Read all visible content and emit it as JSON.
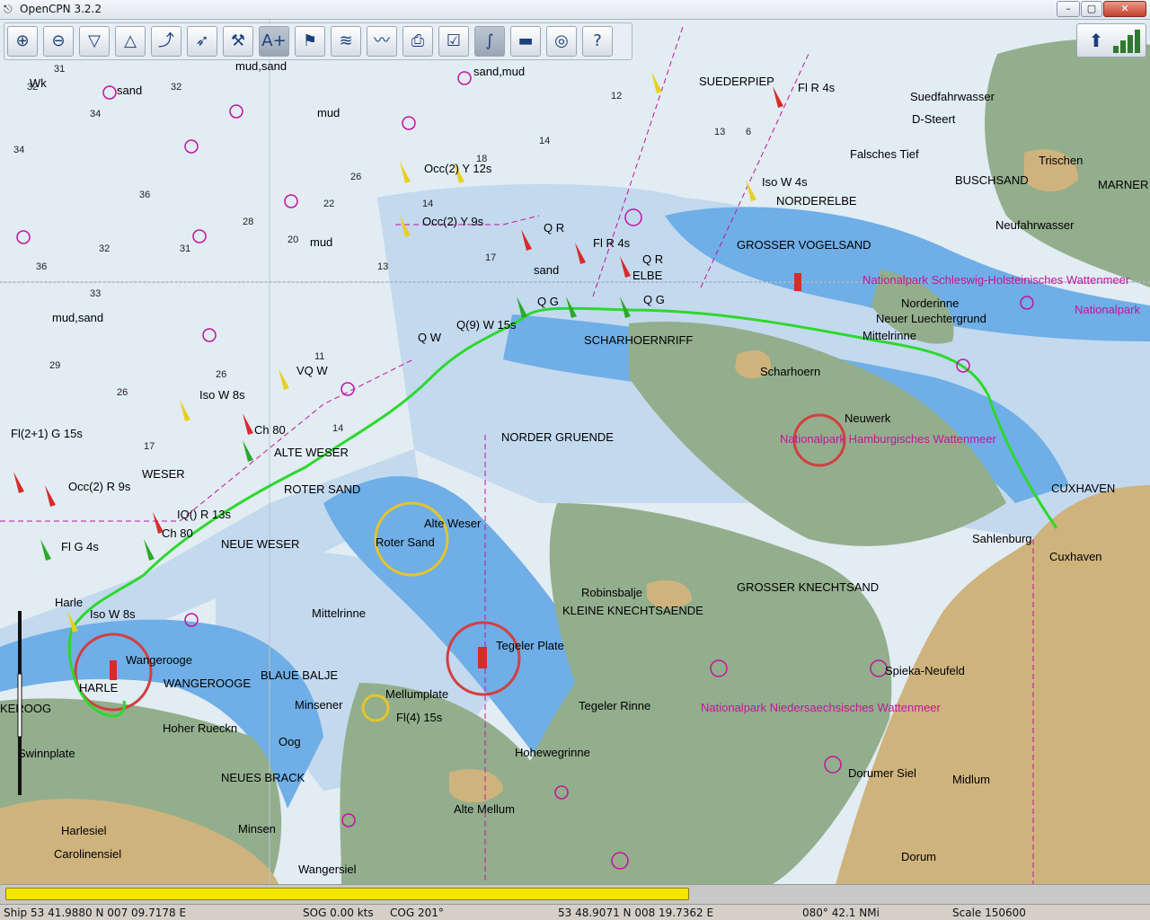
{
  "window": {
    "title": "OpenCPN 3.2.2",
    "controls": [
      "–",
      "▢",
      "✕"
    ]
  },
  "toolbar": {
    "tools": [
      {
        "name": "zoom-in",
        "glyph": "⊕"
      },
      {
        "name": "zoom-out",
        "glyph": "⊖"
      },
      {
        "name": "scale-in",
        "glyph": "▽"
      },
      {
        "name": "scale-out",
        "glyph": "△"
      },
      {
        "name": "route",
        "glyph": "⤴"
      },
      {
        "name": "auto-follow",
        "glyph": "➶"
      },
      {
        "name": "settings",
        "glyph": "⚒"
      },
      {
        "name": "text",
        "glyph": "A+"
      },
      {
        "name": "current",
        "glyph": "⚑"
      },
      {
        "name": "tide",
        "glyph": "≋"
      },
      {
        "name": "chart-info",
        "glyph": "〰"
      },
      {
        "name": "print",
        "glyph": "⎙"
      },
      {
        "name": "route-manager",
        "glyph": "☑"
      },
      {
        "name": "track",
        "glyph": "∫"
      },
      {
        "name": "color-scheme",
        "glyph": "▬"
      },
      {
        "name": "mob",
        "glyph": "◎"
      },
      {
        "name": "help",
        "glyph": "?"
      }
    ],
    "active_tool": "track"
  },
  "chart": {
    "colors": {
      "shallow": "#6faee6",
      "medium": "#c3d9ee",
      "deep": "#e2ecf3",
      "drying": "#93ae8c",
      "land": "#cfb37d",
      "track": "#2dd82d",
      "magenta": "#c2149e"
    },
    "place_labels": [
      "SUEDERPIEP",
      "Suedfahrwasser",
      "D-Steert",
      "Falsches Tief",
      "Trischen",
      "BUSCHSAND",
      "MARNER",
      "NORDERELBE",
      "GROSSER VOGELSAND",
      "Neufahrwasser",
      "ELBE",
      "Norderinne",
      "Neuer Luechtergrund",
      "Mittelrinne",
      "SCHARHOERNRIFF",
      "Scharhoern",
      "Neuwerk",
      "CUXHAVEN",
      "Sahlenburg",
      "Cuxhaven",
      "NORDER GRUENDE",
      "ALTE WESER",
      "ROTER SAND",
      "Alte Weser",
      "Roter Sand",
      "NEUE WESER",
      "WESER",
      "GROSSER KNECHTSAND",
      "Robinsbalje",
      "KLEINE KNECHTSAENDE",
      "Mittelrinne",
      "Tegeler Plate",
      "Tegeler Rinne",
      "Hohewegrinne",
      "Mellumplate",
      "Minsener",
      "BLAUE BALJE",
      "Wangerooge",
      "WANGEROOGE",
      "HARLE",
      "Harle",
      "Hoher Rueckn",
      "Oog",
      "NEUES BRACK",
      "Swinnplate",
      "Harlesiel",
      "Carolinensiel",
      "Minsen",
      "Wangersiel",
      "Alte Mellum",
      "Spieka-Neufeld",
      "Dorumer Siel",
      "Midlum",
      "Dorum",
      "KEROOG"
    ],
    "light_labels": [
      "Fl R 4s",
      "Iso W 4s",
      "Q R",
      "Fl R 4s",
      "Q R",
      "Q G",
      "Q G",
      "Occ(2) Y 12s",
      "Occ(2) Y 9s",
      "Q(9) W 15s",
      "Q W",
      "VQ W",
      "Iso W 8s",
      "Fl(2+1) G 15s",
      "Occ(2) R 9s",
      "IQ() R 13s",
      "Fl G 4s",
      "Iso W 8s",
      "Fl(4) 15s",
      "Ch 80",
      "Ch 80"
    ],
    "magenta_labels": [
      "Nationalpark Hamburgisches Wattenmeer",
      "Nationalpark Niedersaechsisches Wattenmeer",
      "Nationalpark Schleswig-Holsteinisches Wattenmeer",
      "Nationalpark"
    ],
    "seabed_labels": [
      "mud,sand",
      "sand,mud",
      "sand",
      "mud",
      "Wk",
      "mud,sand",
      "mud",
      "sand"
    ]
  },
  "status_icons": {
    "compass": "compass-icon",
    "signal": "signal-strength-icon"
  },
  "progress": {
    "value": 0.6
  },
  "statusbar": {
    "ship": "Ship 53 41.9880 N   007 09.7178 E",
    "sog": "SOG 0.00 kts",
    "cog": "COG 201°",
    "cursor": "53 48.9071 N   008 19.7362 E",
    "bearing": "080°  42.1 NMi",
    "scale": "Scale 150600"
  }
}
